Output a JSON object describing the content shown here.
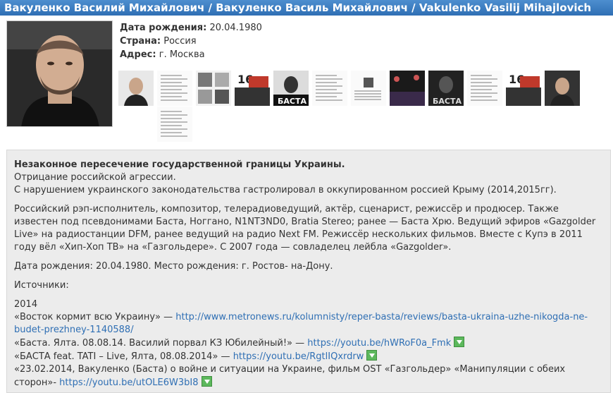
{
  "header": {
    "title": "Вакуленко Василий Михайлович / Вакуленко Василь Михайлович / Vakulenko Vasilij Mihajlovich"
  },
  "profile": {
    "birth_label": "Дата рождения:",
    "birth_value": "20.04.1980",
    "country_label": "Страна:",
    "country_value": "Россия",
    "address_label": "Адрес:",
    "address_value": "г. Москва"
  },
  "gallery": [
    {
      "label": "photo-1",
      "style": "face"
    },
    {
      "label": "photo-2",
      "style": "doc"
    },
    {
      "label": "photo-3",
      "style": "collage"
    },
    {
      "label": "photo-4",
      "style": "poster-16"
    },
    {
      "label": "photo-5",
      "style": "basta-white"
    },
    {
      "label": "photo-6",
      "style": "doc"
    },
    {
      "label": "photo-7",
      "style": "doc-photo"
    },
    {
      "label": "photo-8",
      "style": "concert"
    },
    {
      "label": "photo-9",
      "style": "basta-dark"
    },
    {
      "label": "photo-10",
      "style": "doc"
    },
    {
      "label": "photo-11",
      "style": "poster-16"
    },
    {
      "label": "photo-12",
      "style": "face-dark"
    },
    {
      "label": "photo-13",
      "style": "doc"
    }
  ],
  "content": {
    "headline": "Незаконное пересечение государственной границы Украины.",
    "line1": "Отрицание российской агрессии.",
    "line2": "С нарушением украинского законодательства гастролировал в оккупированном россией Крыму (2014,2015гг).",
    "bio": "Российский рэп-исполнитель, композитор, телерадиоведущий, актёр, сценарист, режиссёр и продюсер. Также известен под псевдонимами Баста, Ноггано, N1NT3ND0, Bratia Stereo; ранее — Баста Хрю. Ведущий эфиров «Gazgolder Live» на радиостанции DFM, ранее ведущий на радио Next FM. Режиссёр нескольких фильмов. Вместе с Купэ в 2011 году вёл «Хип-Хоп ТВ» на «Газгольдере». С 2007 года — совладелец лейбла «Gazgolder».",
    "birth": "Дата рождения: 20.04.1980. Место рождения: г. Ростов- на-Дону.",
    "sources_label": "Источники:",
    "year": "2014",
    "sources": [
      {
        "text": "«Восток кормит всю Украину» — ",
        "link": "http://www.metronews.ru/kolumnisty/reper-basta/reviews/basta-ukraina-uzhe-nikogda-ne-budet-prezhney-1140588/",
        "download": false
      },
      {
        "text": "«Баста. Ялта. 08.08.14. Василий порвал КЗ Юбилейный!» — ",
        "link": "https://youtu.be/hWRoF0a_Fmk",
        "download": true
      },
      {
        "text": "«БАСТА feat. TATI – Live, Ялта, 08.08.2014» — ",
        "link": "https://youtu.be/RgtlIQxrdrw",
        "download": true
      },
      {
        "text": "«23.02.2014, Вакуленко (Баста) о войне и ситуации на Украине, фильм OST «Газгольдер» «Манипуляции с обеих сторон»- ",
        "link": "https://youtu.be/utOLE6W3bI8",
        "download": true
      }
    ]
  }
}
